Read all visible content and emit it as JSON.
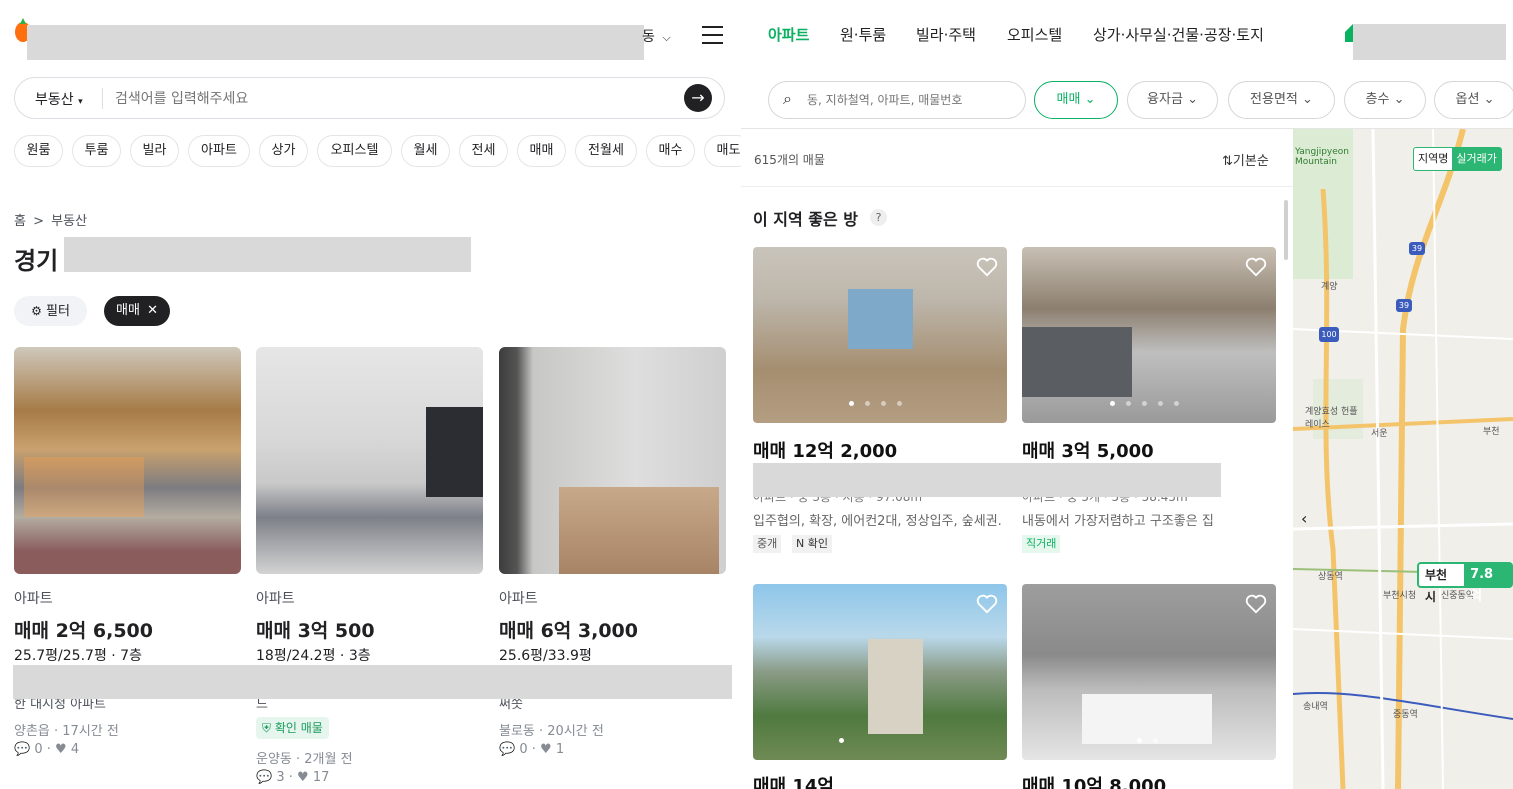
{
  "left": {
    "location_label": "동",
    "search": {
      "category": "부동산",
      "placeholder": "검색어를 입력해주세요"
    },
    "chips": [
      "원룸",
      "투룸",
      "빌라",
      "아파트",
      "상가",
      "오피스텔",
      "월세",
      "전세",
      "매매",
      "전월세",
      "매수",
      "매도"
    ],
    "breadcrumb": {
      "home": "홈",
      "sep": ">",
      "current": "부동산"
    },
    "title": "경기",
    "filter_label": "필터",
    "active_filter": "매매",
    "cards": [
      {
        "type": "아파트",
        "price": "매매 2억 6,500",
        "size": "25.7평/25.7평 · 7층",
        "partial": "한 대시청 아파트",
        "badge": "",
        "place": "양촌읍 · 17시간 전",
        "chats": "0",
        "likes": "4"
      },
      {
        "type": "아파트",
        "price": "매매 3억 500",
        "size": "18평/24.2평 · 3층",
        "partial": "드",
        "badge": "확인 매물",
        "place": "운양동 · 2개월 전",
        "chats": "3",
        "likes": "17"
      },
      {
        "type": "아파트",
        "price": "매매 6억 3,000",
        "size": "25.6평/33.9평",
        "partial": "써쏫",
        "badge": "",
        "place": "불로동 · 20시간 전",
        "chats": "0",
        "likes": "1"
      }
    ]
  },
  "right": {
    "tabs": [
      "아파트",
      "원·투룸",
      "빌라·주택",
      "오피스텔",
      "상가·사무실·건물·공장·토지"
    ],
    "search_placeholder": "동, 지하철역, 아파트, 매물번호",
    "filters": [
      "매매",
      "융자금",
      "전용면적",
      "층수",
      "옵션"
    ],
    "count": "615개의 매물",
    "sort": "기본순",
    "section_title": "이 지역 좋은 방",
    "help": "?",
    "listings": [
      {
        "price": "매매 12억 2,000",
        "partial": "아파트 · 중 3층 · 지층 · 97.08m²",
        "desc": "입주협의, 확장, 에어컨2대, 정상입주, 숲세권.",
        "tags": [
          "중개",
          "N 확인"
        ]
      },
      {
        "price": "매매 3억 5,000",
        "partial": "아파트 · 중 5개 · 5층 · 58.45m²",
        "desc": "내동에서 가장저렴하고 구조좋은 집",
        "tags": [
          "직거래"
        ]
      },
      {
        "price": "매매 14억",
        "partial": "",
        "desc": "",
        "tags": []
      },
      {
        "price": "매매 10억 8,000",
        "partial": "",
        "desc": "",
        "tags": []
      }
    ],
    "map": {
      "toggle_a": "지역명",
      "toggle_b": "실거래가",
      "labels": [
        "Yangjipyeon Mountain",
        "계양",
        "서운",
        "부천",
        "중동역",
        "상동역",
        "부천시청",
        "신중동역",
        "송내역",
        "중동역",
        "계양효성 헌플레이스",
        "양산",
        "부천시청",
        "골우두",
        "부천",
        "송내",
        "산"
      ],
      "road_numbers": [
        "39",
        "39",
        "100"
      ],
      "price_tag_area": "부천시",
      "price_tag_value": "7.8억",
      "colors": {
        "price_tag": "#2bb673"
      }
    },
    "colors": {
      "accent": "#0ab161"
    }
  }
}
